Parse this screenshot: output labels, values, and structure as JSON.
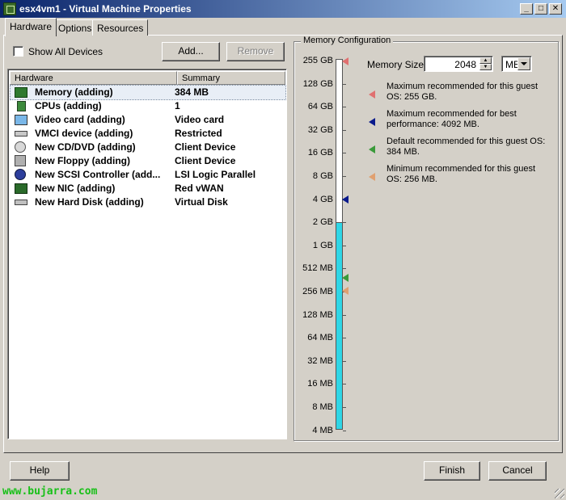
{
  "window": {
    "title": "esx4vm1 - Virtual Machine Properties"
  },
  "tabs": [
    {
      "label": "Hardware",
      "active": true
    },
    {
      "label": "Options",
      "active": false
    },
    {
      "label": "Resources",
      "active": false
    }
  ],
  "show_all_devices": {
    "label": "Show All Devices",
    "checked": false
  },
  "buttons": {
    "add": "Add...",
    "remove": "Remove",
    "help": "Help",
    "finish": "Finish",
    "cancel": "Cancel"
  },
  "hardware_list": {
    "columns": [
      "Hardware",
      "Summary"
    ],
    "rows": [
      {
        "name": "Memory (adding)",
        "summary": "384 MB",
        "icon": "memory-icon",
        "selected": true
      },
      {
        "name": "CPUs (adding)",
        "summary": "1",
        "icon": "cpu-icon"
      },
      {
        "name": "Video card  (adding)",
        "summary": "Video card",
        "icon": "monitor-icon"
      },
      {
        "name": "VMCI device (adding)",
        "summary": "Restricted",
        "icon": "vmci-icon"
      },
      {
        "name": "New CD/DVD (adding)",
        "summary": "Client Device",
        "icon": "cd-dvd-icon"
      },
      {
        "name": "New Floppy (adding)",
        "summary": "Client Device",
        "icon": "floppy-icon"
      },
      {
        "name": "New SCSI Controller (add...",
        "summary": "LSI Logic Parallel",
        "icon": "scsi-icon"
      },
      {
        "name": "New NIC (adding)",
        "summary": "Red vWAN",
        "icon": "nic-icon"
      },
      {
        "name": "New Hard Disk (adding)",
        "summary": "Virtual Disk",
        "icon": "hard-disk-icon"
      }
    ]
  },
  "memory_config": {
    "title": "Memory Configuration",
    "scale_labels": [
      "255 GB",
      "128 GB",
      "64 GB",
      "32 GB",
      "16 GB",
      "8 GB",
      "4 GB",
      "2 GB",
      "1 GB",
      "512 MB",
      "256 MB",
      "128 MB",
      "64 MB",
      "32 MB",
      "16 MB",
      "8 MB",
      "4 MB"
    ],
    "memory_size_label": "Memory Size:",
    "memory_size_value": "2048",
    "unit": "MB",
    "legend": [
      {
        "text": "Maximum recommended for this guest OS: 255 GB.",
        "color": "#e07070"
      },
      {
        "text": "Maximum recommended for best performance: 4092 MB.",
        "color": "#0a1a8c"
      },
      {
        "text": "Default recommended for this guest OS: 384 MB.",
        "color": "#3a9a3a"
      },
      {
        "text": "Minimum recommended for this guest OS: 256 MB.",
        "color": "#e0a070"
      }
    ]
  },
  "footer": {
    "watermark": "www.bujarra.com"
  },
  "colors": {
    "slider_fill": "#2fd6e6",
    "titlebar": "#0a246a",
    "watermark": "#18c018"
  }
}
